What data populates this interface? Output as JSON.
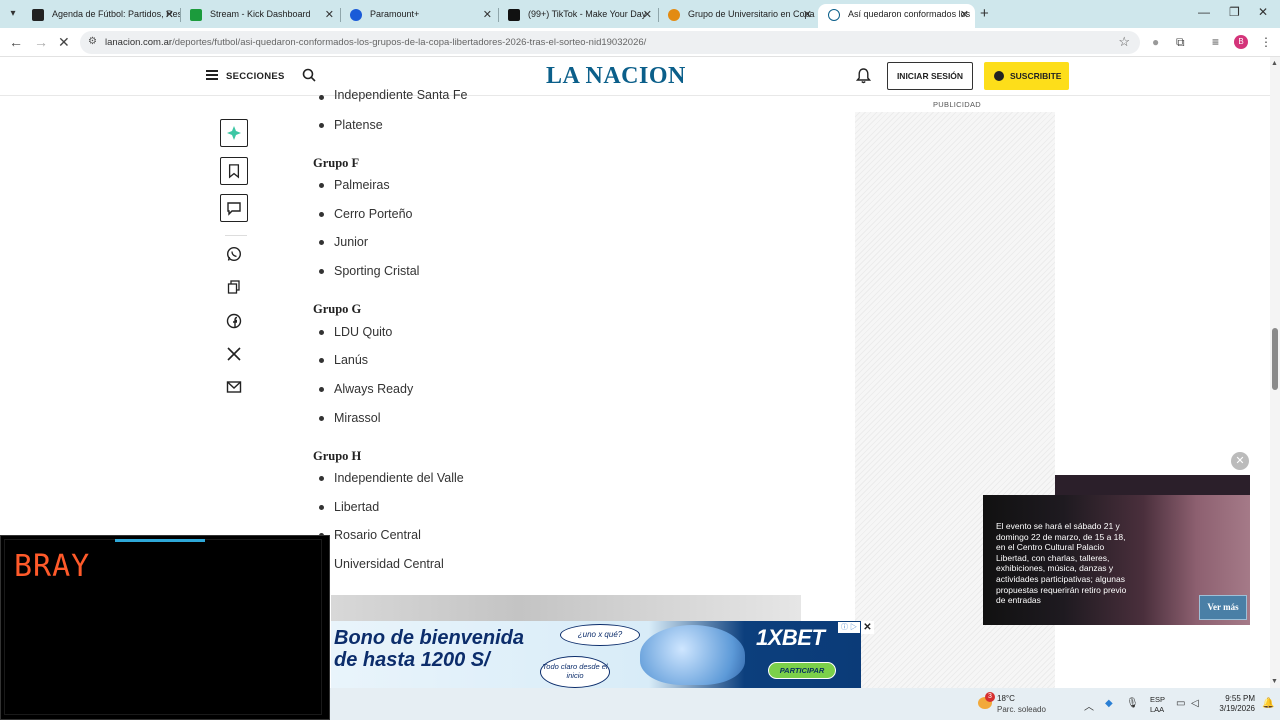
{
  "browser": {
    "tabs": [
      {
        "title": "Agenda de Fútbol: Partidos, Res",
        "favicon_color": "#222222"
      },
      {
        "title": "Stream - Kick Dashboard",
        "favicon_color": "#1b9b3c"
      },
      {
        "title": "Paramount+",
        "favicon_color": "#1a5bd8"
      },
      {
        "title": "(99+) TikTok - Make Your Day",
        "favicon_color": "#111111"
      },
      {
        "title": "Grupo de Universitario en Copa",
        "favicon_color": "#e38b12"
      },
      {
        "title": "Así quedaron conformados los",
        "favicon_color": "#0b5f8a",
        "active": true
      }
    ],
    "url_host": "lanacion.com.ar",
    "url_path": "/deportes/futbol/asi-quedaron-conformados-los-grupos-de-la-copa-libertadores-2026-tras-el-sorteo-nid19032026/",
    "profile_initial": "B"
  },
  "header": {
    "secciones": "SECCIONES",
    "logo": "LA NACION",
    "login": "INICIAR SESIÓN",
    "subscribe": "SUSCRIBITE"
  },
  "article": {
    "top_partial": "Independiente Santa Fe",
    "top_item": "Platense",
    "groups": [
      {
        "title": "Grupo F",
        "teams": [
          "Palmeiras",
          "Cerro Porteño",
          "Junior",
          "Sporting Cristal"
        ]
      },
      {
        "title": "Grupo G",
        "teams": [
          "LDU Quito",
          "Lanús",
          "Always Ready",
          "Mirassol"
        ]
      },
      {
        "title": "Grupo H",
        "teams": [
          "Independiente del Valle",
          "Libertad",
          "Rosario Central",
          "Universidad Central"
        ]
      }
    ]
  },
  "sidebar": {
    "publicidad": "PUBLICIDAD"
  },
  "floating_video": {
    "text": "El evento se hará el sábado 21 y domingo 22 de marzo, de 15 a 18, en el Centro Cultural Palacio Libertad, con charlas, talleres, exhibiciones, música, danzas y actividades participativas; algunas propuestas requerirán retiro previo de entradas",
    "button": "Ver más"
  },
  "banner_ad": {
    "line1": "Bono de bienvenida",
    "line2": "de hasta 1200 S/",
    "bubble1": "¿uno x qué?",
    "bubble2": "Todo claro desde el inicio",
    "brand": "1XBET",
    "cta": "PARTICIPAR"
  },
  "stream_overlay": {
    "name": "BRAY"
  },
  "taskbar": {
    "weather_badge": "3",
    "temp": "18°C",
    "condition": "Parc. soleado",
    "lang1": "ESP",
    "lang2": "LAA",
    "time": "9:55 PM",
    "date": "3/19/2026"
  }
}
